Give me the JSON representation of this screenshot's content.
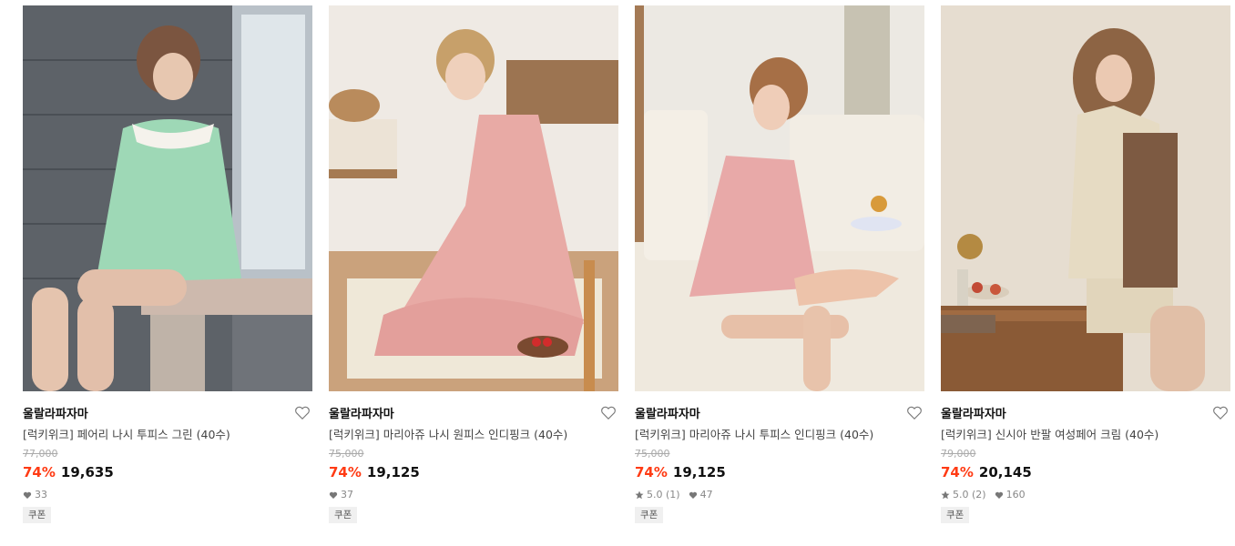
{
  "colors": {
    "discount": "#ff3b14",
    "text": "#111111",
    "muted": "#888888"
  },
  "products": [
    {
      "brand": "울랄라파자마",
      "title": "[럭키위크] 페어리 나시 투피스 그린 (40수)",
      "original_price": "77,000",
      "discount": "74%",
      "price": "19,635",
      "rating": "",
      "likes": "33",
      "coupon": "쿠폰",
      "image_desc": "green-floral-pajama"
    },
    {
      "brand": "울랄라파자마",
      "title": "[럭키위크] 마리아쥬 나시 원피스 인디핑크 (40수)",
      "original_price": "75,000",
      "discount": "74%",
      "price": "19,125",
      "rating": "",
      "likes": "37",
      "coupon": "쿠폰",
      "image_desc": "pink-floral-dress"
    },
    {
      "brand": "울랄라파자마",
      "title": "[럭키위크] 마리아쥬 나시 투피스 인디핑크 (40수)",
      "original_price": "75,000",
      "discount": "74%",
      "price": "19,125",
      "rating": "5.0 (1)",
      "likes": "47",
      "coupon": "쿠폰",
      "image_desc": "pink-floral-set-on-sofa"
    },
    {
      "brand": "울랄라파자마",
      "title": "[럭키위크] 신시아 반팔 여성페어 크림 (40수)",
      "original_price": "79,000",
      "discount": "74%",
      "price": "20,145",
      "rating": "5.0 (2)",
      "likes": "160",
      "coupon": "쿠폰",
      "image_desc": "cream-short-sleeve-set"
    }
  ]
}
